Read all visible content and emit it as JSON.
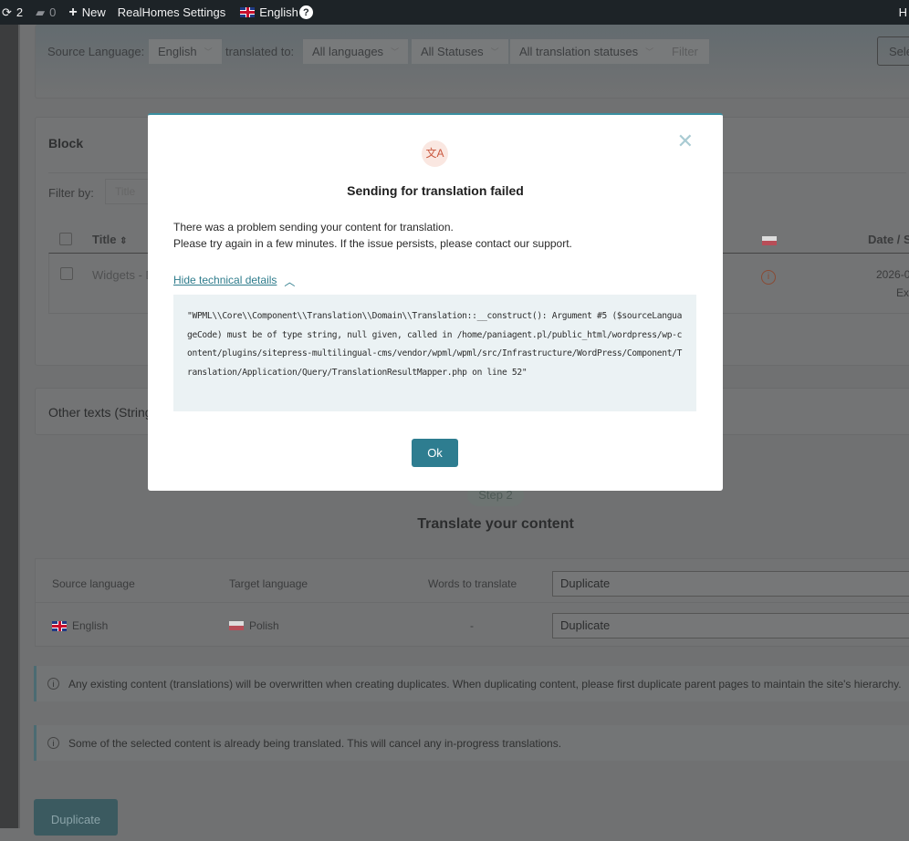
{
  "adminbar": {
    "updates": "2",
    "comments": "0",
    "new": "New",
    "settings": "RealHomes Settings",
    "language": "English",
    "help": "?",
    "right_cut": "H"
  },
  "filters": {
    "source_label": "Source Language:",
    "source_value": "English",
    "translated_to": "translated to:",
    "languages": "All languages",
    "statuses": "All Statuses",
    "translation_statuses": "All translation statuses",
    "filter": "Filter",
    "select": "Sele"
  },
  "block": {
    "title": "Block",
    "filter_by": "Filter by:",
    "filter_placeholder": "Title",
    "col_title": "Title",
    "col_date": "Date / St",
    "row_title": "Widgets - D",
    "row_date": "2026-0",
    "row_status": "Ext"
  },
  "other": {
    "title": "Other texts (String"
  },
  "step": {
    "badge": "Step 2",
    "title": "Translate your content"
  },
  "langtable": {
    "headers": [
      "Source language",
      "Target language",
      "Words to translate"
    ],
    "source": "English",
    "target": "Polish",
    "words": "-",
    "method_header": "Duplicate",
    "method_row": "Duplicate"
  },
  "notices": [
    "Any existing content (translations) will be overwritten when creating duplicates. When duplicating content, please first duplicate parent pages to maintain the site's hierarchy.",
    "Some of the selected content is already being translated. This will cancel any in-progress translations."
  ],
  "duplicate_button": "Duplicate",
  "modal": {
    "icon": "文A",
    "title": "Sending for translation failed",
    "line1": "There was a problem sending your content for translation.",
    "line2": "Please try again in a few minutes. If the issue persists, please contact our support.",
    "toggle": "Hide technical details",
    "error": "\"WPML\\\\Core\\\\Component\\\\Translation\\\\Domain\\\\Translation::__construct(): Argument #5 ($sourceLanguageCode) must be of type string, null given, called in /home/paniagent.pl/public_html/wordpress/wp-content/plugins/sitepress-multilingual-cms/vendor/wpml/wpml/src/Infrastructure/WordPress/Component/Translation/Application/Query/TranslationResultMapper.php on line 52\"",
    "ok": "Ok"
  }
}
